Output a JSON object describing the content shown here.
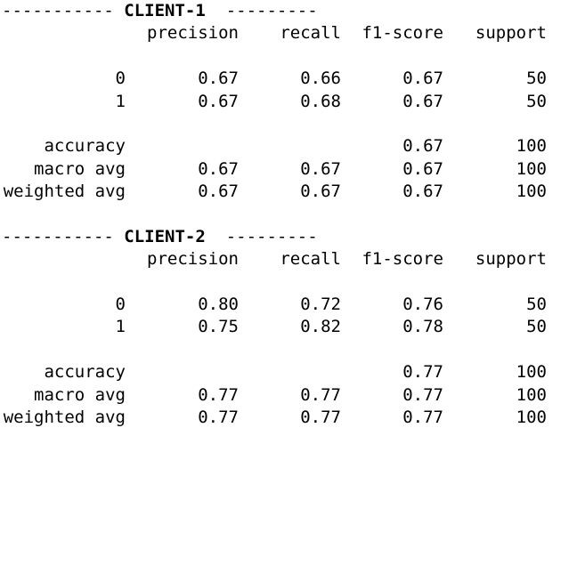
{
  "headers": {
    "precision": "precision",
    "recall": "recall",
    "f1": "f1-score",
    "support": "support"
  },
  "clients": [
    {
      "dashes_left": "-----------",
      "title": "CLIENT-1",
      "dashes_right": "---------",
      "rows": [
        {
          "label": "0",
          "precision": "0.67",
          "recall": "0.66",
          "f1": "0.67",
          "support": "50"
        },
        {
          "label": "1",
          "precision": "0.67",
          "recall": "0.68",
          "f1": "0.67",
          "support": "50"
        }
      ],
      "accuracy": {
        "label": "accuracy",
        "f1": "0.67",
        "support": "100"
      },
      "macro": {
        "label": "macro avg",
        "precision": "0.67",
        "recall": "0.67",
        "f1": "0.67",
        "support": "100"
      },
      "weighted": {
        "label": "weighted avg",
        "precision": "0.67",
        "recall": "0.67",
        "f1": "0.67",
        "support": "100"
      }
    },
    {
      "dashes_left": "-----------",
      "title": "CLIENT-2",
      "dashes_right": "---------",
      "rows": [
        {
          "label": "0",
          "precision": "0.80",
          "recall": "0.72",
          "f1": "0.76",
          "support": "50"
        },
        {
          "label": "1",
          "precision": "0.75",
          "recall": "0.82",
          "f1": "0.78",
          "support": "50"
        }
      ],
      "accuracy": {
        "label": "accuracy",
        "f1": "0.77",
        "support": "100"
      },
      "macro": {
        "label": "macro avg",
        "precision": "0.77",
        "recall": "0.77",
        "f1": "0.77",
        "support": "100"
      },
      "weighted": {
        "label": "weighted avg",
        "precision": "0.77",
        "recall": "0.77",
        "f1": "0.77",
        "support": "100"
      }
    }
  ]
}
